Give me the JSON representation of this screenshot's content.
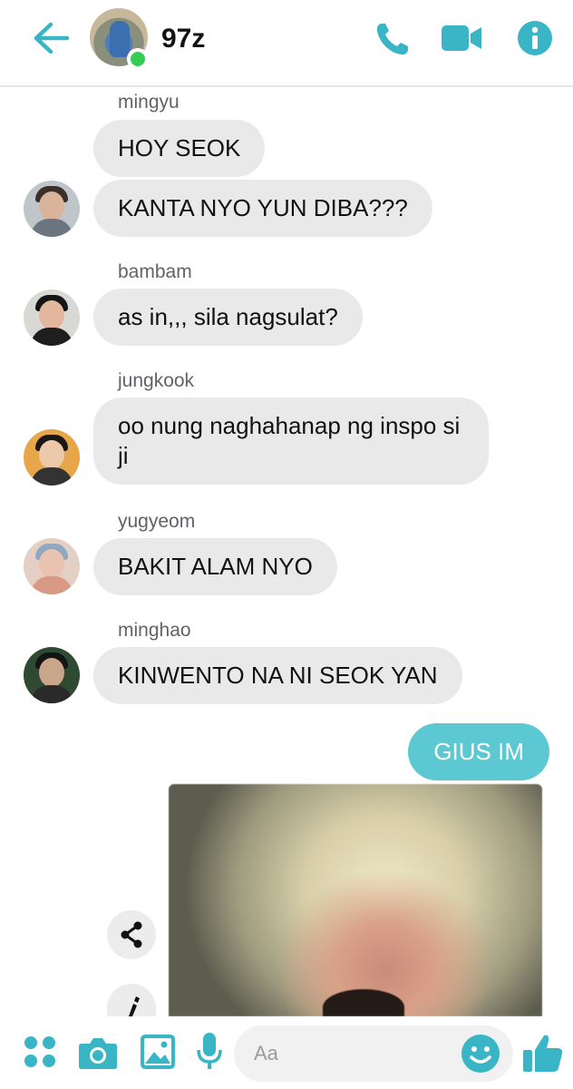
{
  "header": {
    "title": "97z",
    "back_icon": "arrow-left-icon",
    "call_icon": "phone-icon",
    "video_icon": "video-camera-icon",
    "info_icon": "info-icon",
    "online": true
  },
  "messages": [
    {
      "sender": "mingyu",
      "bubbles": [
        "HOY SEOK",
        "KANTA NYO YUN DIBA???"
      ]
    },
    {
      "sender": "bambam",
      "bubbles": [
        "as in,,, sila nagsulat?"
      ]
    },
    {
      "sender": "jungkook",
      "bubbles": [
        "oo nung naghahanap ng inspo si ji"
      ]
    },
    {
      "sender": "yugyeom",
      "bubbles": [
        "BAKIT ALAM NYO"
      ]
    },
    {
      "sender": "minghao",
      "bubbles": [
        "KINWENTO NA NI SEOK YAN"
      ]
    }
  ],
  "my_message": "GIUS IM",
  "composer": {
    "placeholder": "Aa",
    "icons": [
      "apps-icon",
      "camera-icon",
      "image-icon",
      "microphone-icon",
      "emoji-icon",
      "thumbs-up-icon"
    ]
  },
  "colors": {
    "accent": "#3ab5c6",
    "bubble_in": "#e9e9ea",
    "bubble_out": "#5bc8d2",
    "online": "#33cc55"
  }
}
